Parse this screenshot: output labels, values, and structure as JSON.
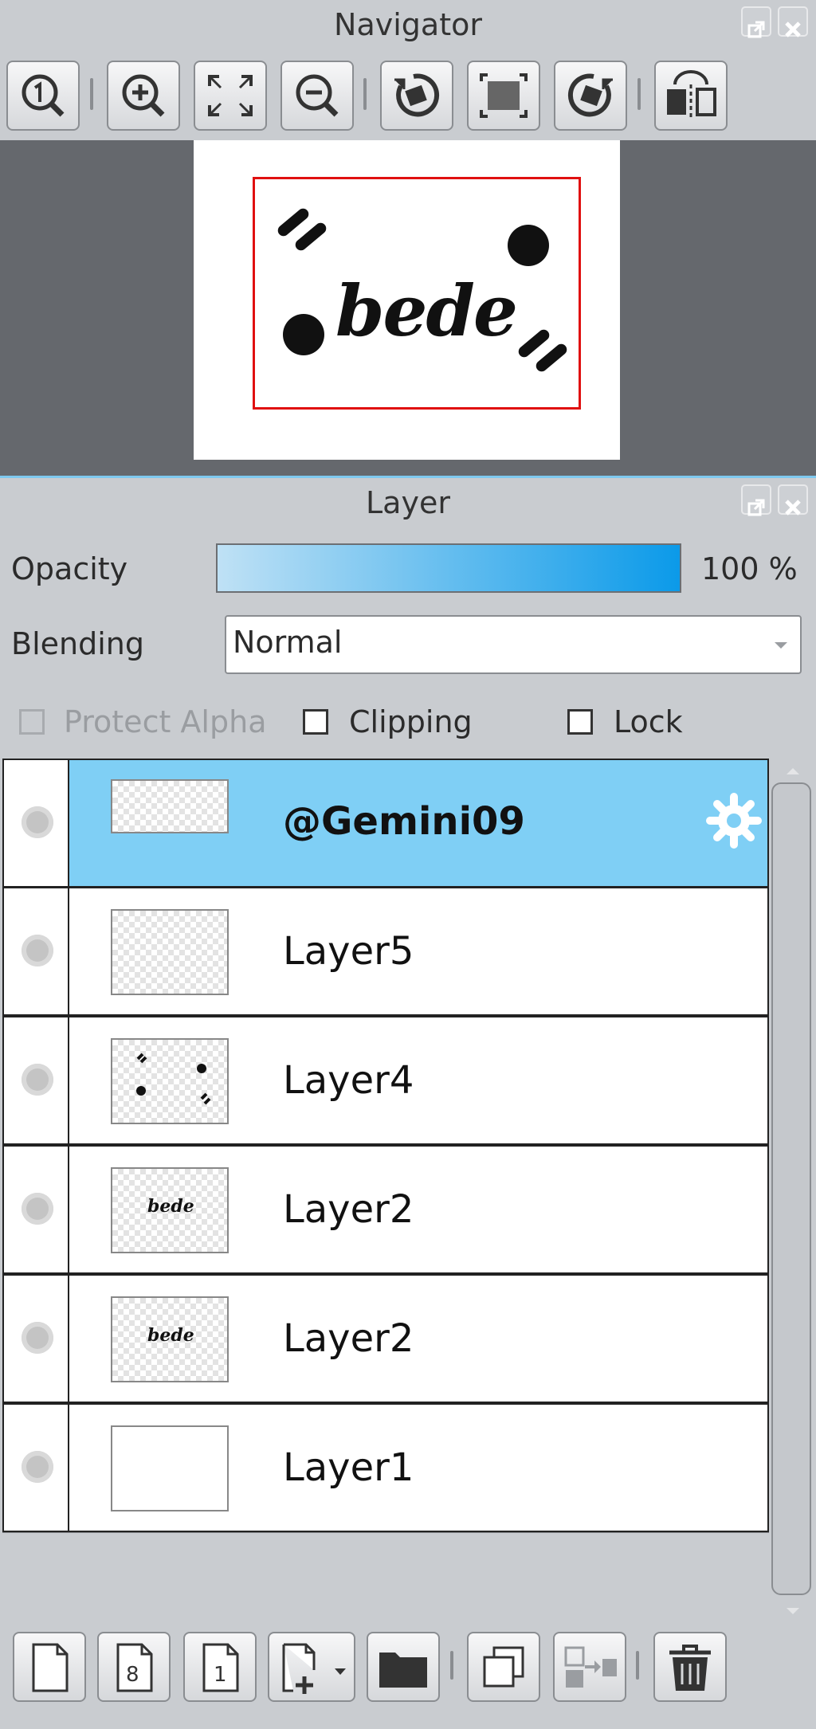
{
  "navigator": {
    "title": "Navigator",
    "canvas_text": "bede",
    "toolbar": [
      {
        "icon": "zoom-actual-size-icon"
      },
      {
        "icon": "zoom-in-icon"
      },
      {
        "icon": "fit-to-screen-icon"
      },
      {
        "icon": "zoom-out-icon"
      },
      {
        "icon": "rotate-left-icon"
      },
      {
        "icon": "reset-rotation-icon"
      },
      {
        "icon": "rotate-right-icon"
      },
      {
        "icon": "flip-horizontal-icon"
      }
    ]
  },
  "layer_panel": {
    "title": "Layer",
    "opacity_label": "Opacity",
    "opacity_value": "100 %",
    "blending_label": "Blending",
    "blending_value": "Normal",
    "protect_alpha_label": "Protect Alpha",
    "clipping_label": "Clipping",
    "lock_label": "Lock",
    "layers": [
      {
        "name": "@Gemini09",
        "selected": true
      },
      {
        "name": "Layer5"
      },
      {
        "name": "Layer4"
      },
      {
        "name": "Layer2"
      },
      {
        "name": "Layer2"
      },
      {
        "name": "Layer1"
      }
    ],
    "thumb_text": "bede",
    "bottom_buttons": [
      {
        "icon": "new-layer-icon"
      },
      {
        "icon": "new-8bit-layer-icon"
      },
      {
        "icon": "new-1bit-layer-icon"
      },
      {
        "icon": "add-layer-menu-icon"
      },
      {
        "icon": "new-folder-icon"
      },
      {
        "icon": "duplicate-layer-icon"
      },
      {
        "icon": "merge-down-icon"
      },
      {
        "icon": "delete-layer-icon"
      }
    ]
  },
  "colors": {
    "selected_row": "#7fcff5",
    "frame_red": "#e01010",
    "opacity_start": "#bfe1f5",
    "opacity_end": "#0b9ae9"
  }
}
